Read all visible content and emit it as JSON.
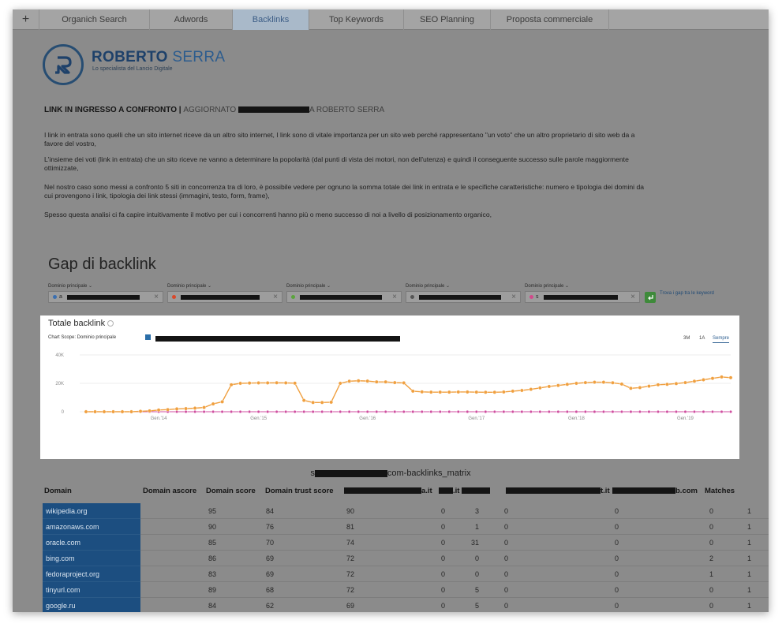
{
  "tabs": [
    {
      "label": "Organich Search",
      "active": false
    },
    {
      "label": "Adwords",
      "active": false
    },
    {
      "label": "Backlinks",
      "active": true
    },
    {
      "label": "Top Keywords",
      "active": false
    },
    {
      "label": "SEO Planning",
      "active": false
    },
    {
      "label": "Proposta commerciale",
      "active": false
    }
  ],
  "tab_add_glyph": "+",
  "logo": {
    "initial": "R",
    "name_bold": "ROBERTO",
    "name_light": "SERRA",
    "tagline": "Lo specialista del Lancio Digitale"
  },
  "intro": {
    "title_bold": "LINK IN INGRESSO A CONFRONTO | ",
    "title_muted_1": "AGGIORNATO ",
    "title_muted_2": "A ROBERTO SERRA",
    "p1": "I link in entrata sono quelli che un sito internet riceve da un altro sito internet, I link sono di vitale importanza per un sito web perché rappresentano \"un voto\" che un altro proprietario di sito web da a favore del vostro,",
    "p2": "L'insieme dei voti (link in entrata) che un sito riceve ne vanno a determinare la popolarità (dal punti di vista dei motori, non dell'utenza) e quindi il conseguente successo sulle parole maggiormente ottimizzate,",
    "p3": "Nel nostro caso sono messi a confronto 5 siti in concorrenza tra di loro, è possibile vedere per ognuno la somma totale dei link in entrata e le specifiche caratteristiche: numero e tipologia dei domini da cui provengono i link, tipologia dei link stessi (immagini, testo, form, frame),",
    "p4": "Spesso questa analisi ci fa capire intuitivamente il motivo per cui i concorrenti hanno più o meno successo di noi a livello di posizionamento organico,"
  },
  "gap": {
    "title": "Gap di backlink",
    "domain_label": "Dominio principale ⌄",
    "domains": [
      {
        "prefix": "a",
        "dot_color": "#3b6fb0"
      },
      {
        "prefix": "",
        "dot_color": "#d9482b"
      },
      {
        "prefix": "",
        "dot_color": "#5aa43c"
      },
      {
        "prefix": "",
        "dot_color": "#555555"
      },
      {
        "prefix": "s",
        "dot_color": "#d14a8b"
      }
    ],
    "find_label": "Trova i gap tra le keyword"
  },
  "chart_panel": {
    "title": "Totale backlink",
    "scope_label": "Chart Scope: Dominio principale",
    "ranges": [
      {
        "label": "3M",
        "active": false
      },
      {
        "label": "1A",
        "active": false
      },
      {
        "label": "Sempre",
        "active": true
      }
    ]
  },
  "chart_data": {
    "type": "line",
    "title": "Totale backlink",
    "x_ticks": [
      "Gen.'14",
      "Gen.'15",
      "Gen.'16",
      "Gen.'17",
      "Gen.'18",
      "Gen.'19"
    ],
    "y_ticks": [
      "0",
      "20K",
      "40K"
    ],
    "ylim": [
      0,
      40000
    ],
    "xlim": [
      0,
      60
    ],
    "grid": true,
    "legend": "none",
    "series": [
      {
        "color": "#f0a040",
        "values": [
          0,
          0,
          0,
          0,
          0,
          0,
          300,
          600,
          1200,
          1500,
          2000,
          2200,
          2500,
          3000,
          5500,
          7000,
          19000,
          20000,
          20200,
          20300,
          20300,
          20400,
          20300,
          20100,
          8000,
          6500,
          6500,
          6700,
          20000,
          21500,
          21800,
          21600,
          21000,
          21000,
          20500,
          20300,
          14500,
          14000,
          13800,
          13800,
          13800,
          13900,
          13900,
          13800,
          13700,
          13700,
          13900,
          14500,
          15000,
          15800,
          16800,
          17800,
          18500,
          19300,
          20000,
          20500,
          20800,
          20800,
          20400,
          19500,
          16500,
          17000,
          18000,
          19000,
          19300,
          19800,
          20500,
          21500,
          22500,
          23500,
          24500,
          24000
        ]
      },
      {
        "color": "#9a9a9a",
        "values": [
          0,
          0,
          0,
          0,
          0,
          0,
          0,
          0,
          0,
          0,
          0,
          0,
          0,
          0,
          0,
          0,
          0,
          0,
          0,
          0,
          0,
          0,
          0,
          0,
          0,
          0,
          0,
          0,
          0,
          0,
          0,
          0,
          0,
          0,
          0,
          0,
          0,
          0,
          0,
          0,
          0,
          0,
          0,
          0,
          0,
          0,
          0,
          0,
          0,
          0,
          0,
          0,
          0,
          0,
          0,
          0,
          0,
          0,
          0,
          0,
          0,
          0,
          0,
          0,
          0,
          0,
          0,
          0,
          0,
          0,
          0,
          0
        ]
      },
      {
        "color": "#d04fa0",
        "values": [
          0,
          0,
          0,
          0,
          0,
          0,
          0,
          0,
          0,
          0,
          0,
          0,
          0,
          0,
          0,
          0,
          0,
          0,
          0,
          0,
          0,
          0,
          0,
          0,
          0,
          0,
          0,
          0,
          0,
          0,
          0,
          0,
          0,
          0,
          0,
          0,
          0,
          0,
          0,
          0,
          0,
          0,
          0,
          0,
          0,
          0,
          0,
          0,
          0,
          0,
          0,
          0,
          0,
          0,
          0,
          0,
          0,
          0,
          0,
          0,
          0,
          0,
          0,
          0,
          0,
          0,
          0,
          0,
          0,
          0,
          0,
          0
        ]
      },
      {
        "color": "#5a3a2a",
        "values": [
          0,
          0,
          0,
          0,
          0,
          0,
          0,
          0,
          0,
          0,
          0,
          0,
          0,
          0,
          0,
          0,
          0,
          0,
          0,
          0,
          0,
          0,
          0,
          0,
          0,
          0,
          0,
          0,
          0,
          0,
          0,
          0,
          0,
          0,
          0,
          0,
          0,
          0,
          0,
          0,
          0,
          0,
          0,
          0,
          0,
          0,
          0,
          0,
          0,
          0,
          0,
          0,
          0,
          0,
          0,
          0,
          0,
          0,
          0,
          0,
          0,
          0,
          0,
          0,
          0,
          0,
          0,
          0,
          0,
          0,
          0,
          0
        ]
      }
    ]
  },
  "matrix": {
    "title_prefix": "s",
    "title_suffix": "com-backlinks_matrix",
    "headers": {
      "domain": "Domain",
      "ascore": "Domain ascore",
      "score": "Domain score",
      "trust": "Domain trust score",
      "c1_suffix": "a.it",
      "c2_suffix": ".it",
      "c4_suffix": "t.it",
      "c5_suffix": "b.com",
      "matches": "Matches"
    },
    "rows": [
      {
        "domain": "wikipedia.org",
        "ascore": "95",
        "score": "84",
        "trust": "90",
        "c1": "0",
        "c2": "3",
        "c3": "0",
        "c4": "0",
        "c5": "0",
        "matches": "1"
      },
      {
        "domain": "amazonaws.com",
        "ascore": "90",
        "score": "76",
        "trust": "81",
        "c1": "0",
        "c2": "1",
        "c3": "0",
        "c4": "0",
        "c5": "0",
        "matches": "1"
      },
      {
        "domain": "oracle.com",
        "ascore": "85",
        "score": "70",
        "trust": "74",
        "c1": "0",
        "c2": "31",
        "c3": "0",
        "c4": "0",
        "c5": "0",
        "matches": "1"
      },
      {
        "domain": "bing.com",
        "ascore": "86",
        "score": "69",
        "trust": "72",
        "c1": "0",
        "c2": "0",
        "c3": "0",
        "c4": "0",
        "c5": "2",
        "matches": "1"
      },
      {
        "domain": "fedoraproject.org",
        "ascore": "83",
        "score": "69",
        "trust": "72",
        "c1": "0",
        "c2": "0",
        "c3": "0",
        "c4": "0",
        "c5": "1",
        "matches": "1"
      },
      {
        "domain": "tinyurl.com",
        "ascore": "89",
        "score": "68",
        "trust": "72",
        "c1": "0",
        "c2": "5",
        "c3": "0",
        "c4": "0",
        "c5": "0",
        "matches": "1"
      },
      {
        "domain": "google.ru",
        "ascore": "84",
        "score": "62",
        "trust": "69",
        "c1": "0",
        "c2": "5",
        "c3": "0",
        "c4": "0",
        "c5": "0",
        "matches": "1"
      }
    ]
  }
}
